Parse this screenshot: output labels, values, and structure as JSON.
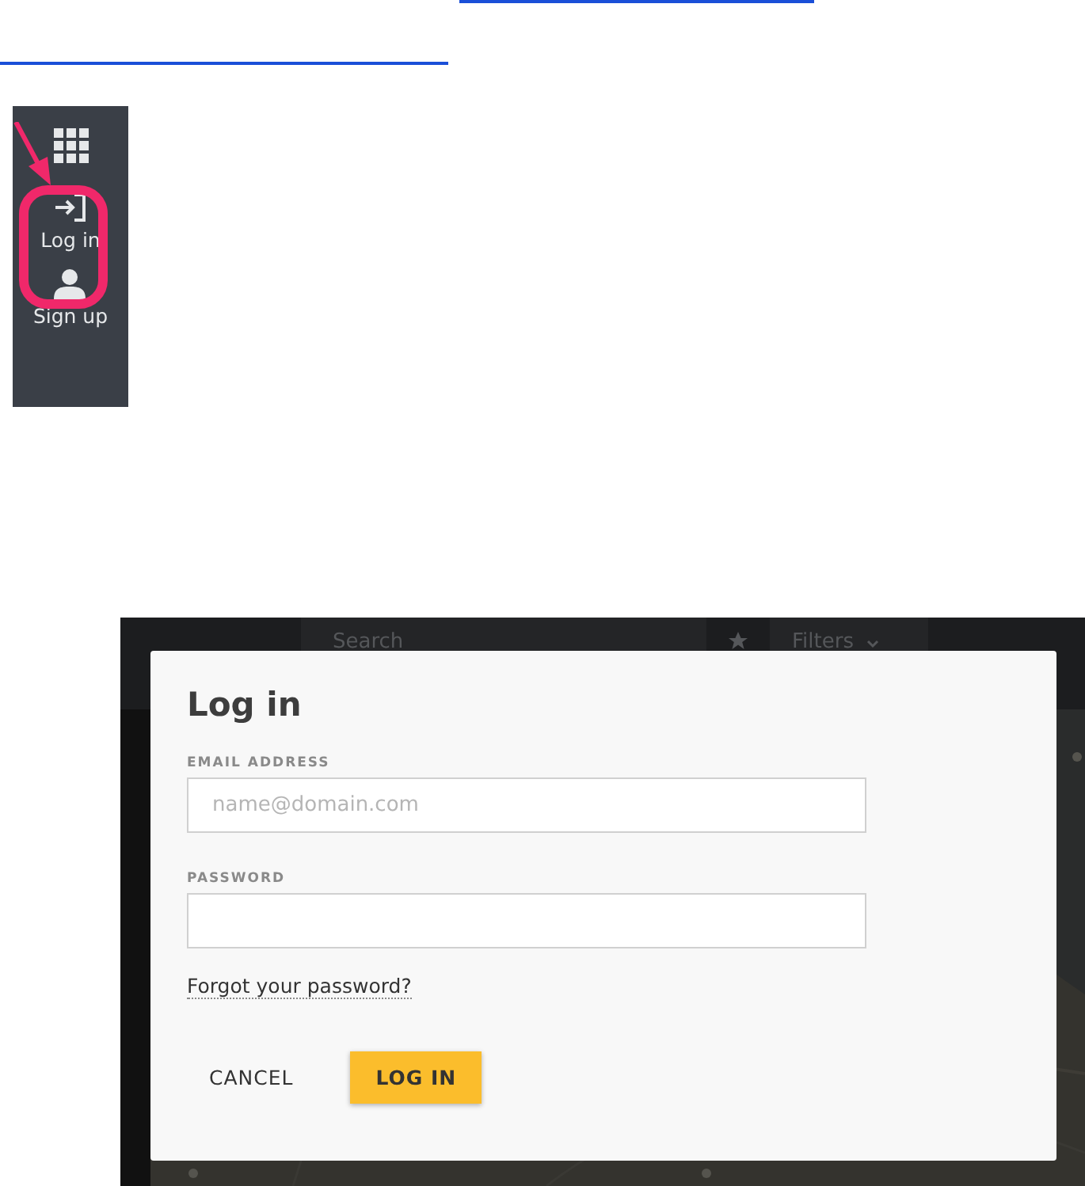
{
  "sidebar": {
    "items": [
      {
        "kind": "apps"
      },
      {
        "kind": "login",
        "label": "Log in",
        "highlighted": true
      },
      {
        "kind": "signup",
        "label": "Sign up"
      }
    ]
  },
  "background_app": {
    "search": {
      "placeholder": "Search"
    },
    "filters": {
      "label": "Filters"
    }
  },
  "dialog": {
    "title": "Log in",
    "fields": [
      {
        "label": "EMAIL ADDRESS",
        "placeholder": "name@domain.com"
      },
      {
        "label": "PASSWORD"
      }
    ],
    "forgot_link": "Forgot your password?",
    "buttons": [
      {
        "label": "CANCEL",
        "primary": false
      },
      {
        "label": "LOG IN",
        "primary": true
      }
    ]
  }
}
